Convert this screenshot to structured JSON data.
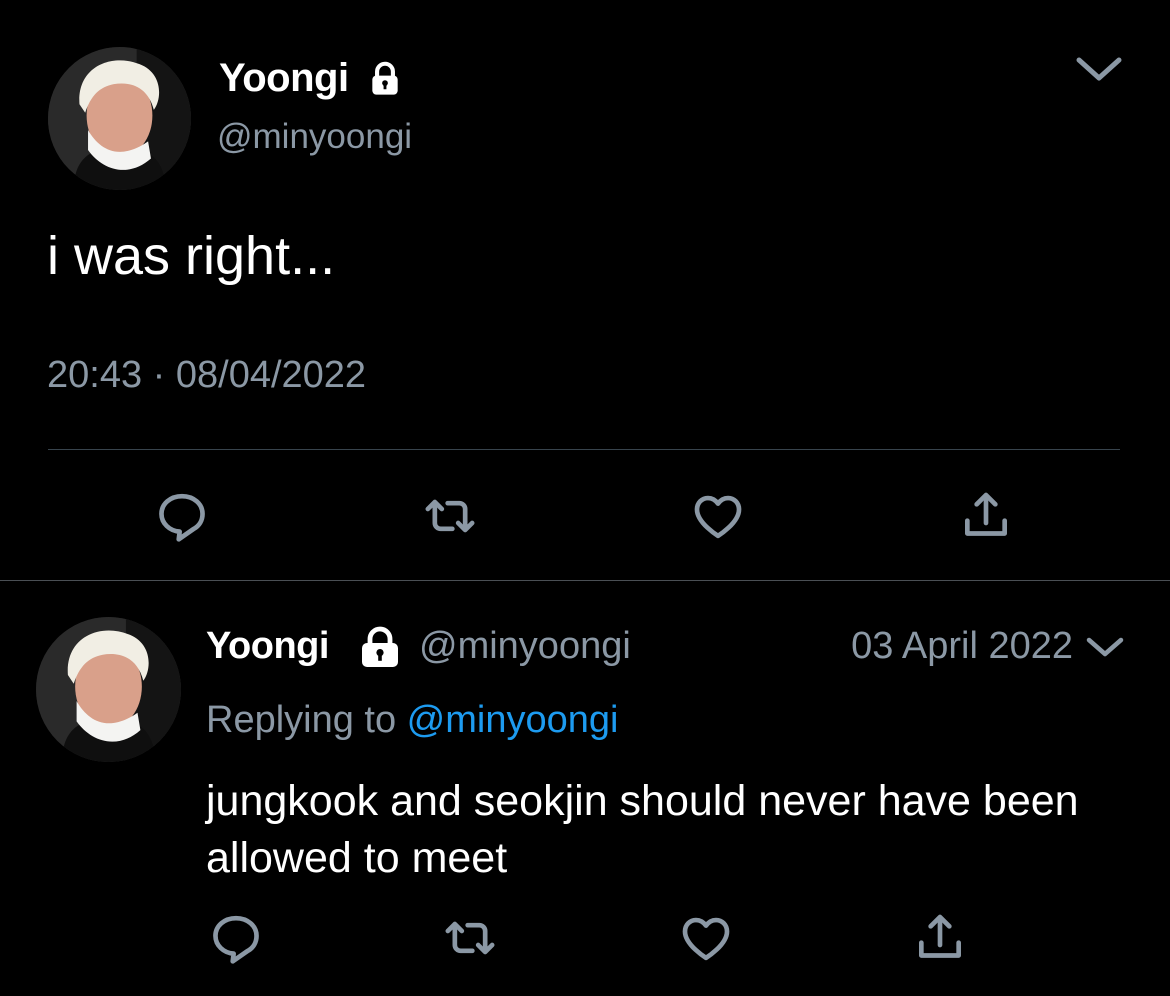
{
  "colors": {
    "background": "#000000",
    "primary_text": "#ffffff",
    "secondary_text": "#8b98a5",
    "link": "#1d9bf0",
    "divider": "#38444d"
  },
  "main_tweet": {
    "display_name": "Yoongi",
    "handle": "@minyoongi",
    "protected_icon": "lock-icon",
    "menu_icon": "chevron-down-icon",
    "text": "i was right...",
    "timestamp": "20:43 · 08/04/2022",
    "actions": [
      "reply-icon",
      "retweet-icon",
      "like-icon",
      "share-icon"
    ]
  },
  "reply_tweet": {
    "display_name": "Yoongi",
    "handle": "@minyoongi",
    "protected_icon": "lock-icon",
    "date": "03 April 2022",
    "menu_icon": "chevron-down-icon",
    "replying_prefix": "Replying to ",
    "replying_mention": "@minyoongi",
    "text": "jungkook and seokjin should never have been allowed to meet",
    "actions": [
      "reply-icon",
      "retweet-icon",
      "like-icon",
      "share-icon"
    ]
  }
}
